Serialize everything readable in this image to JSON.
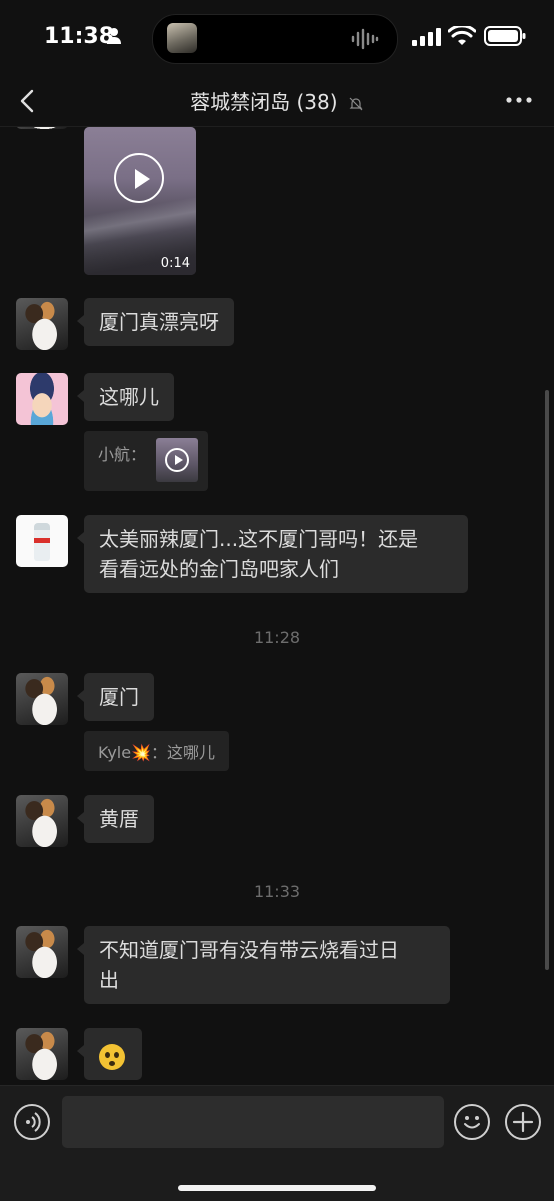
{
  "status_bar": {
    "time": "11:38"
  },
  "nav": {
    "title": "蓉城禁闭岛 (38)"
  },
  "messages": {
    "video": {
      "duration": "0:14"
    },
    "m1": {
      "text": "厦门真漂亮呀"
    },
    "m2": {
      "text": "这哪儿",
      "quote_sender": "小航："
    },
    "m3": {
      "line1": "太美丽辣厦门...这不厦门哥吗！还是",
      "line2": "看看远处的金门岛吧家人们"
    },
    "ts1": "11:28",
    "m4": {
      "text": "厦门",
      "quote": "Kyle💥：这哪儿"
    },
    "m5": {
      "text": "黄厝"
    },
    "ts2": "11:33",
    "m6": {
      "line1": "不知道厦门哥有没有带云烧看过日",
      "line2": "出"
    },
    "m7": {
      "emoji": "flushed-emoji"
    }
  },
  "input": {
    "placeholder": ""
  }
}
